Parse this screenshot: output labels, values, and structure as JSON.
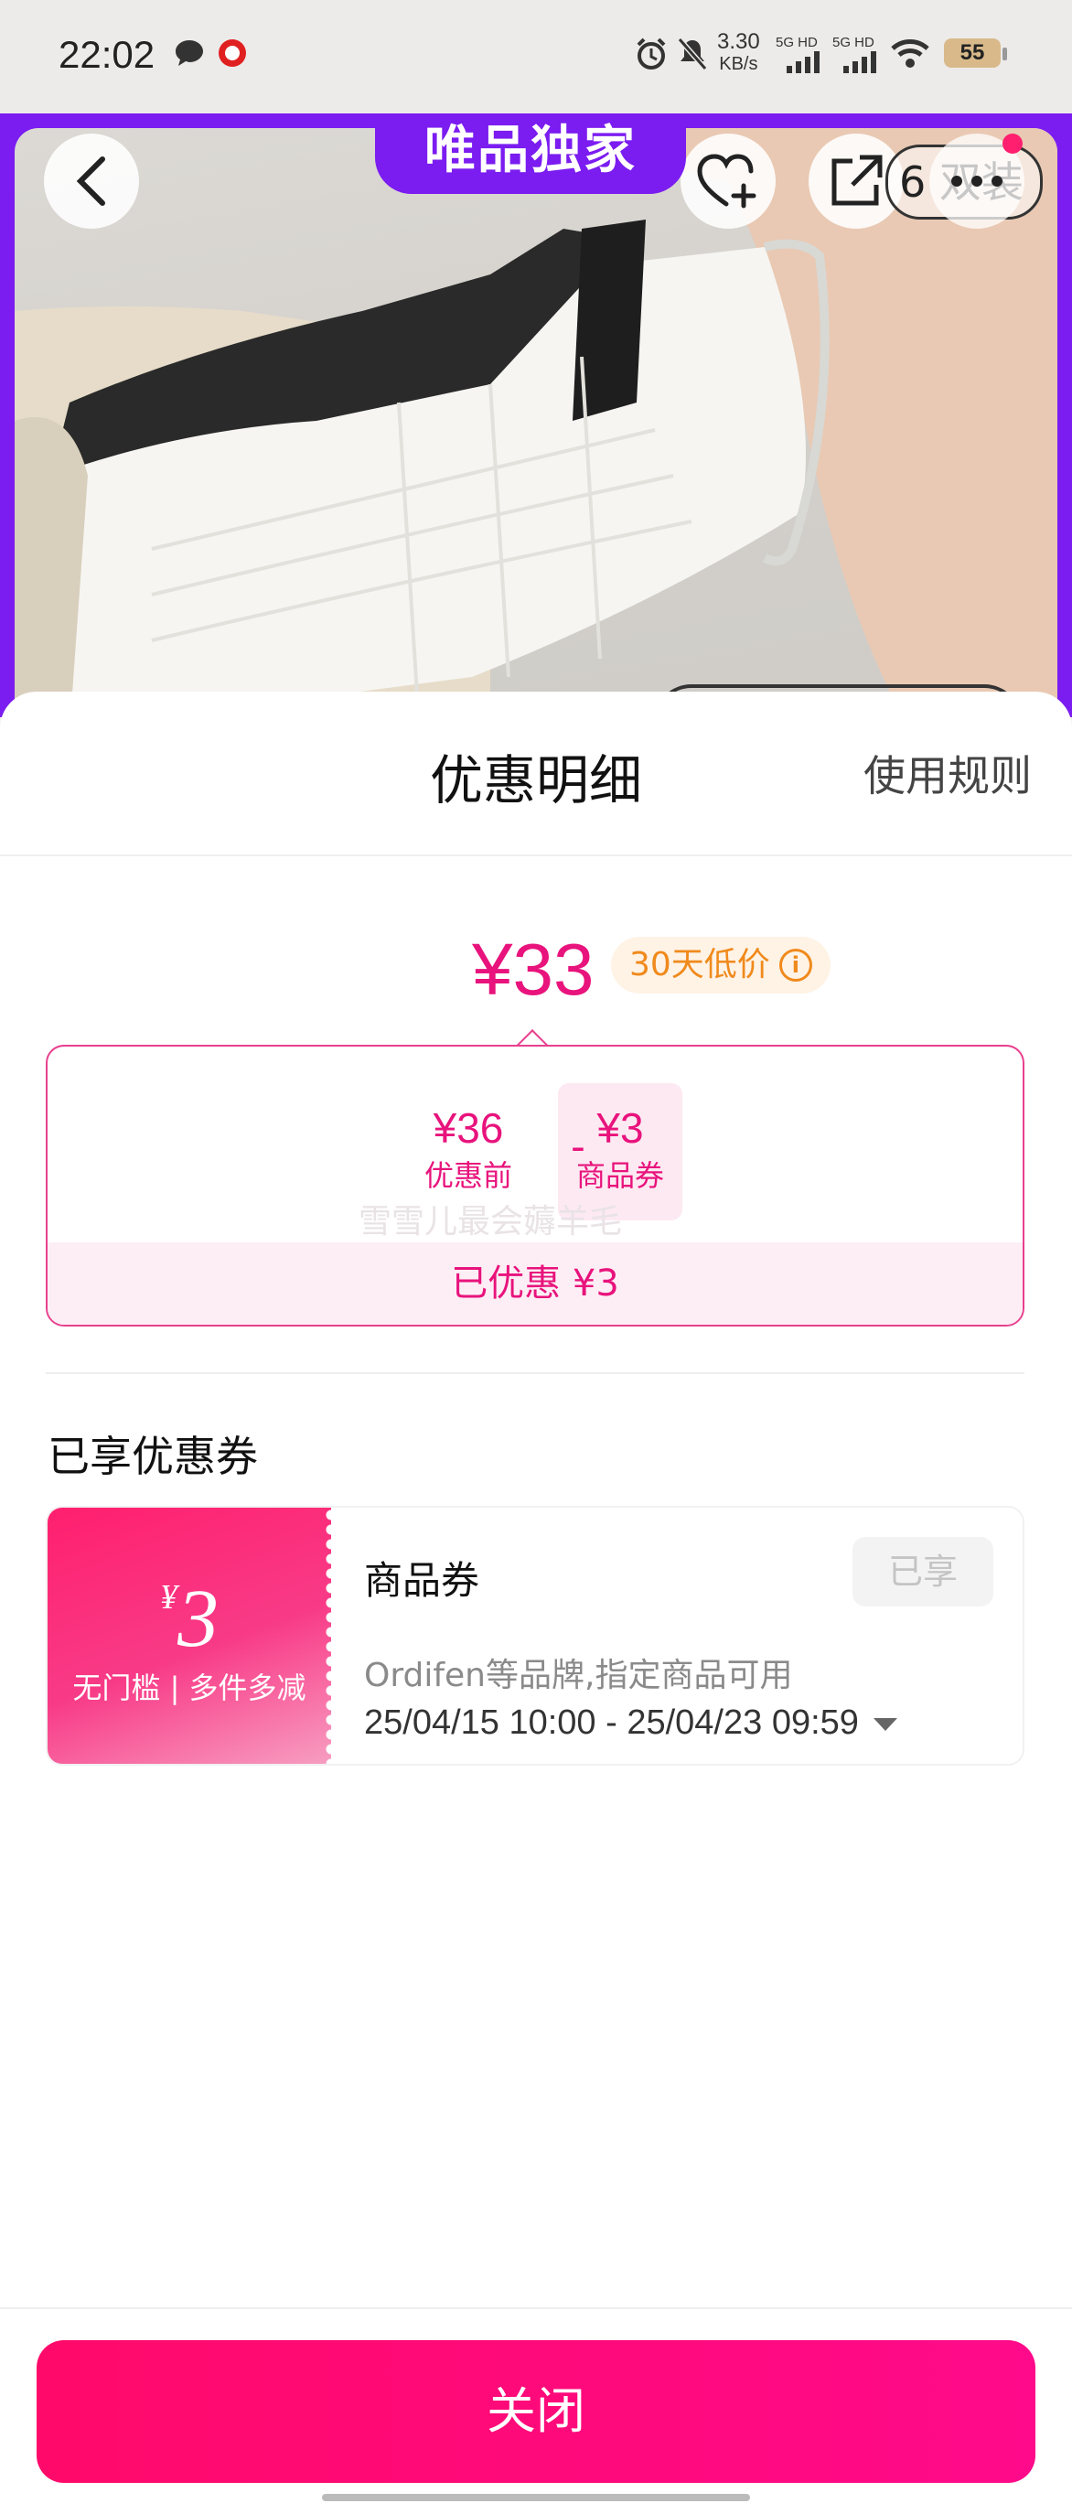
{
  "status_bar": {
    "time": "22:02",
    "net_speed_value": "3.30",
    "net_speed_unit": "KB/s",
    "sim1": "5G HD",
    "sim2": "5G HD",
    "battery": "55"
  },
  "product_header": {
    "exclusive_label": "唯品独家",
    "partial_tag": "6 双装"
  },
  "sheet": {
    "title": "优惠明细",
    "rules_link": "使用规则",
    "final_price": "¥33",
    "low_price_tag": "30天低价",
    "breakdown": {
      "original_value": "¥36",
      "original_label": "优惠前",
      "minus": "-",
      "coupon_value": "¥3",
      "coupon_label": "商品券",
      "saved_text": "已优惠 ¥3",
      "watermark": "雪雪儿最会薅羊毛"
    },
    "section_title": "已享优惠券",
    "coupon": {
      "currency": "¥",
      "amount": "3",
      "condition": "无门槛 | 多件多减",
      "name": "商品券",
      "status": "已享",
      "description": "Ordifen等品牌,指定商品可用",
      "validity": "25/04/15 10:00 - 25/04/23 09:59"
    },
    "close_button": "关闭"
  },
  "colors": {
    "brand_purple": "#7b1cf0",
    "accent_pink": "#e8137c",
    "close_button": "#ff0a6a",
    "low_price_orange": "#f08a1c"
  }
}
